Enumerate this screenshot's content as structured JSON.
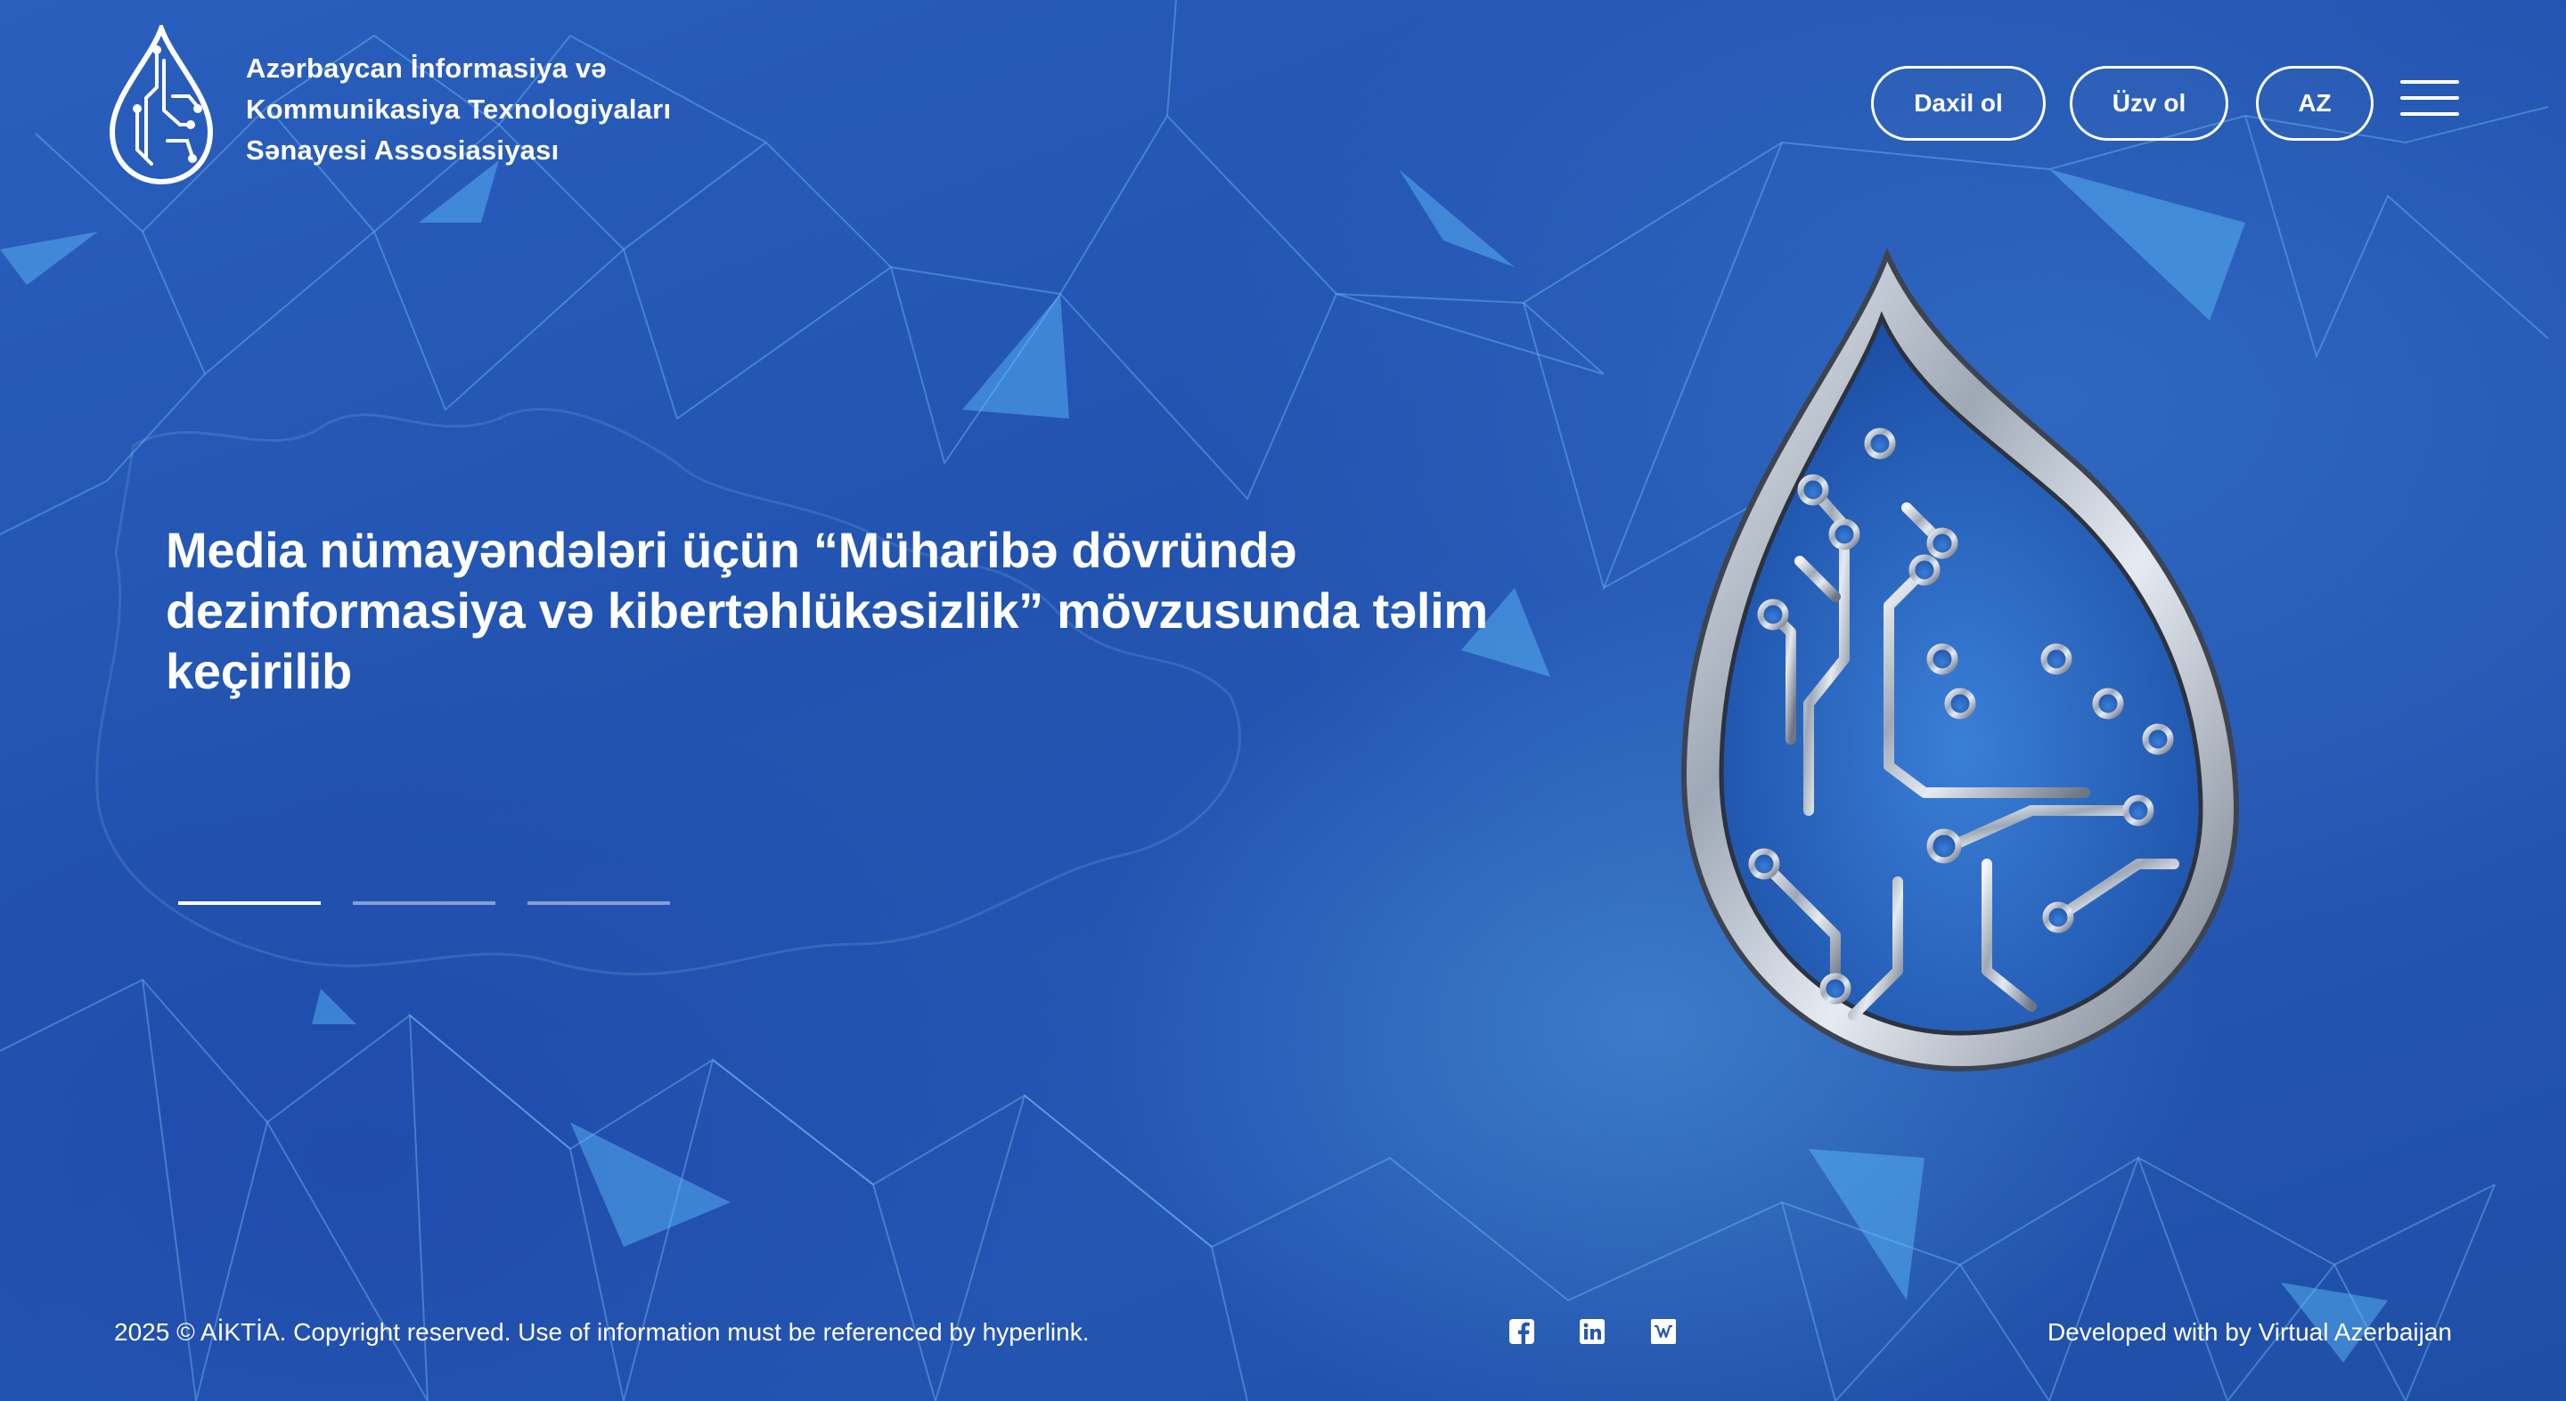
{
  "header": {
    "brand_lines": [
      "Azərbaycan İnformasiya və",
      "Kommunikasiya Texnologiyaları",
      "Sənayesi Assosiasiyası"
    ],
    "login_label": "Daxil ol",
    "member_label": "Üzv ol",
    "language_label": "AZ",
    "logo_icon": "droplet-circuit-logo-icon",
    "menu_icon": "hamburger-menu-icon"
  },
  "hero": {
    "headline_lines": [
      "Media nümayəndələri üçün “Müharibə dövründə",
      "dezinformasiya və kibertəhlükəsizlik” mövzusunda təlim",
      "keçirilib"
    ],
    "slides_total": 3,
    "active_slide": 1,
    "emblem_icon": "metallic-droplet-circuit-emblem"
  },
  "footer": {
    "copyright": "2025 © AİKTİA. Copyright reserved. Use of information must be referenced by hyperlink.",
    "social_icons": [
      "facebook-icon",
      "linkedin-icon",
      "wikipedia-icon"
    ],
    "developed_by": "Developed with by Virtual Azerbaijan"
  },
  "colors": {
    "background": "#2457b4",
    "text": "#ffffff",
    "accent": "#4fb6f2"
  }
}
